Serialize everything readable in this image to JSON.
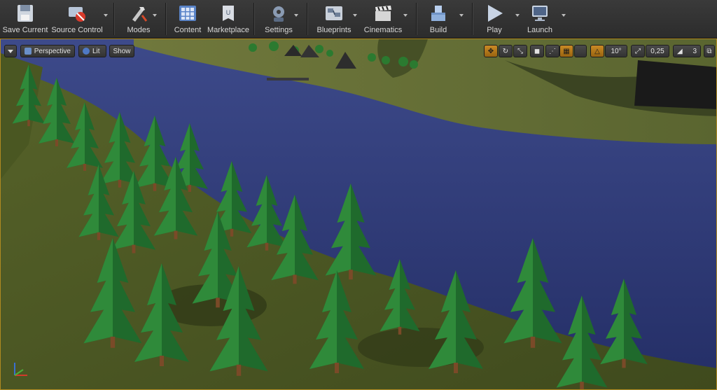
{
  "toolbar": {
    "save": "Save Current",
    "source_control": "Source Control",
    "modes": "Modes",
    "content": "Content",
    "marketplace": "Marketplace",
    "settings": "Settings",
    "blueprints": "Blueprints",
    "cinematics": "Cinematics",
    "build": "Build",
    "play": "Play",
    "launch": "Launch"
  },
  "viewport": {
    "perspective": "Perspective",
    "lit": "Lit",
    "show": "Show",
    "grid_snap_value": "",
    "rotation_snap": "10°",
    "scale_snap": "0,25",
    "camera_speed": "3"
  },
  "colors": {
    "toolbar_bg": "#2c2c2c",
    "accent_orange": "#c98a25",
    "viewport_border": "#b08a20",
    "water": "#2e3a7a",
    "grass": "#5e6b2e"
  }
}
